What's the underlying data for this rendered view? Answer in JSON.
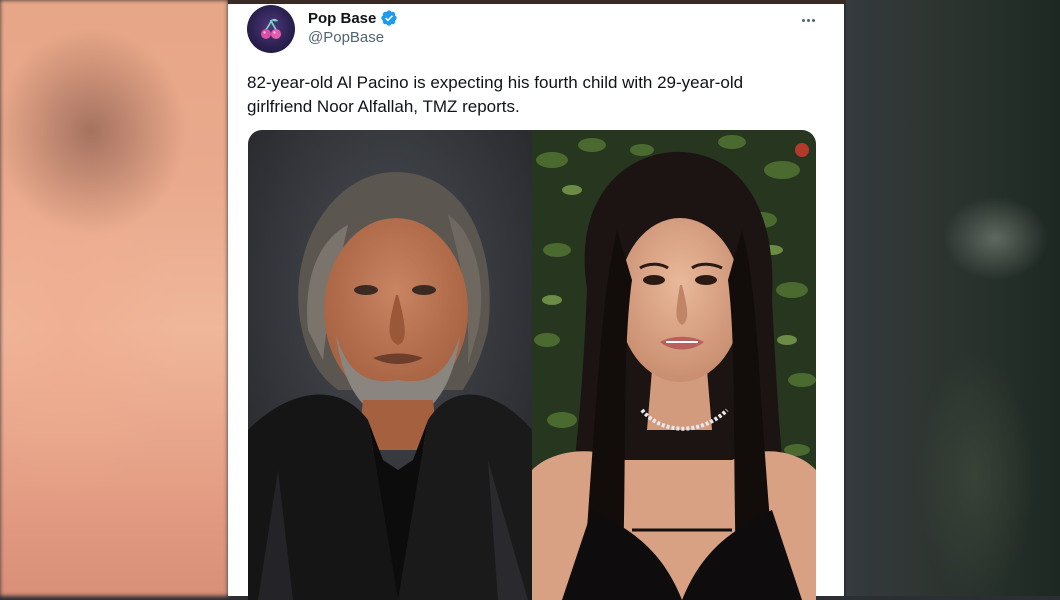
{
  "tweet": {
    "display_name": "Pop Base",
    "handle": "@PopBase",
    "text_line1": "82-year-old Al Pacino is expecting his fourth child with 29-year-old",
    "text_line2": "girlfriend Noor Alfallah, TMZ reports.",
    "verified": true
  },
  "colors": {
    "verified_blue": "#1d9bf0",
    "name_text": "#0f1419",
    "secondary_text": "#536471"
  },
  "icons": {
    "verified": "verified-badge-icon",
    "more": "more-options-icon",
    "avatar": "cherry-logo-icon"
  }
}
